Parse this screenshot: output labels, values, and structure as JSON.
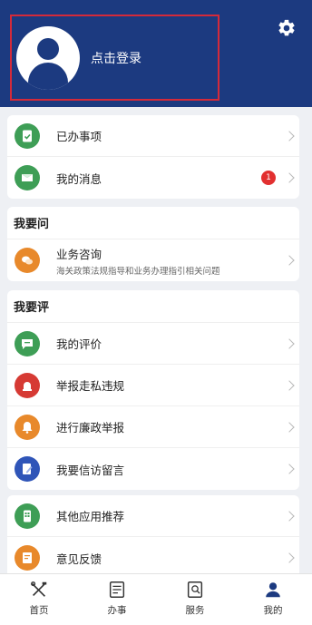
{
  "header": {
    "login_text": "点击登录",
    "bg_color": "#1c3a80",
    "highlight_color": "#d42a3a"
  },
  "card1": {
    "items": [
      {
        "label": "已办事项",
        "icon": "document-check-icon",
        "color": "#3e9e56"
      },
      {
        "label": "我的消息",
        "icon": "envelope-icon",
        "color": "#3e9e56",
        "badge": "1"
      }
    ]
  },
  "ask": {
    "title": "我要问",
    "items": [
      {
        "label": "业务咨询",
        "sub": "海关政策法规指导和业务办理指引相关问题",
        "icon": "chat-bubbles-icon",
        "color": "#e8892b"
      }
    ]
  },
  "review": {
    "title": "我要评",
    "items": [
      {
        "label": "我的评价",
        "icon": "comment-icon",
        "color": "#3e9e56"
      },
      {
        "label": "举报走私违规",
        "icon": "alarm-light-icon",
        "color": "#d63a34"
      },
      {
        "label": "进行廉政举报",
        "icon": "bell-icon",
        "color": "#e8892b"
      },
      {
        "label": "我要信访留言",
        "icon": "edit-note-icon",
        "color": "#2f55b8"
      }
    ]
  },
  "card4": {
    "items": [
      {
        "label": "其他应用推荐",
        "icon": "phone-apps-icon",
        "color": "#3e9e56"
      },
      {
        "label": "意见反馈",
        "icon": "feedback-form-icon",
        "color": "#e8892b"
      }
    ]
  },
  "tabbar": {
    "tabs": [
      {
        "label": "首页",
        "icon": "home-tools-icon"
      },
      {
        "label": "办事",
        "icon": "checklist-icon"
      },
      {
        "label": "服务",
        "icon": "service-search-icon"
      },
      {
        "label": "我的",
        "icon": "user-icon",
        "active": true
      }
    ]
  }
}
